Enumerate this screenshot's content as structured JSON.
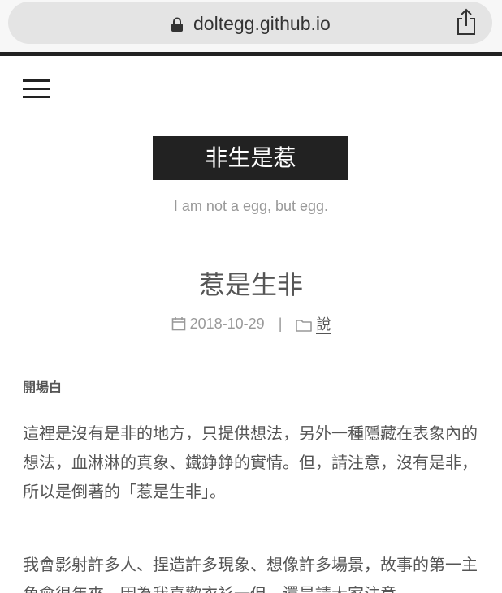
{
  "browser": {
    "url": "doltegg.github.io"
  },
  "site": {
    "title": "非生是惹",
    "subtitle": "I am not a egg, but egg."
  },
  "post": {
    "title": "惹是生非",
    "date": "2018-10-29",
    "separator": "|",
    "category": "說",
    "section_heading": "開場白",
    "paragraphs": [
      "這裡是沒有是非的地方，只提供想法，另外一種隱藏在表象內的想法，血淋淋的真象、鐵錚錚的實情。但，請注意，沒有是非，所以是倒著的「惹是生非」。",
      "我會影射許多人、捏造許多現象、想像許多場景，故事的第一主角會很年來，因為我喜歡衣衫一但，還是請大家注意"
    ]
  },
  "icons": {
    "lock": "lock-icon",
    "share": "share-icon",
    "menu": "hamburger-menu-icon",
    "calendar": "calendar-icon",
    "folder": "folder-icon"
  }
}
